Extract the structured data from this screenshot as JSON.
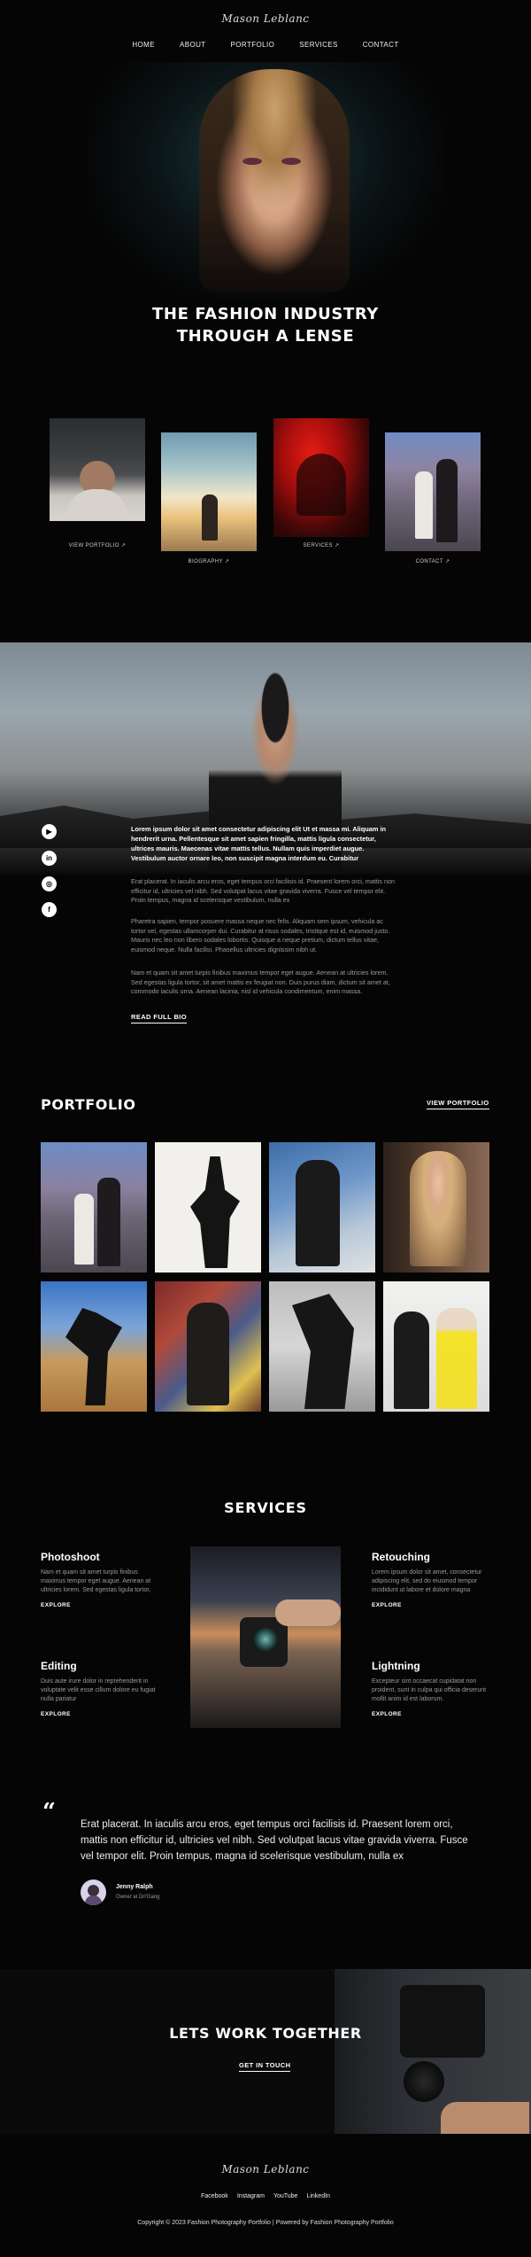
{
  "brand": {
    "logo": "Mason Leblanc"
  },
  "nav": {
    "items": [
      "HOME",
      "ABOUT",
      "PORTFOLIO",
      "SERVICES",
      "CONTACT"
    ]
  },
  "hero": {
    "title_line1": "THE FASHION INDUSTRY",
    "title_line2": "THROUGH A LENSE"
  },
  "cards": [
    {
      "label": "VIEW PORTFOLIO",
      "icon": "external-link-icon"
    },
    {
      "label": "BIOGRAPHY",
      "icon": "external-link-icon"
    },
    {
      "label": "SERVICES",
      "icon": "external-link-icon"
    },
    {
      "label": "CONTACT",
      "icon": "external-link-icon"
    }
  ],
  "social": [
    "youtube-icon",
    "linkedin-icon",
    "instagram-icon",
    "facebook-icon"
  ],
  "bio": {
    "lead": "Lorem ipsum dolor sit amet consectetur adipiscing elit Ut et massa mi. Aliquam in hendrerit urna. Pellentesque sit amet sapien fringilla, mattis ligula consectetur, ultrices mauris. Maecenas vitae mattis tellus. Nullam quis imperdiet augue. Vestibulum auctor ornare leo, non suscipit magna interdum eu. Curabitur",
    "p1": "Erat placerat. In iaculis arcu eros, eget tempus orci facilisis id. Praesent lorem orci, mattis non efficitur id, ultricies vel nibh. Sed volutpat lacus vitae gravida viverra. Fusce vel tempor elit. Proin tempus, magna id scelerisque vestibulum, nulla ex",
    "p2": "Pharetra sapien, tempor posuere massa neque nec felis. Aliquam sem ipsum, vehicula ac tortor vel, egestas ullamcorper dui. Curabitur at risus sodales, tristique est id, euismod justo. Mauris nec leo non libero sodales lobortis. Quisque a neque pretium, dictum tellus vitae, euismod neque. Nulla facilisi. Phasellus ultricies dignissim nibh ut.",
    "p3": "Nam et quam sit amet turpis finibus maximus tempor eget augue. Aenean at ultricies lorem. Sed egestas ligula tortor, sit amet mattis ex feugiat non. Duis purus diam, dictum sit amet at, commodo iaculis urna. Aenean lacinia, nisl id vehicula condimentum, enim massa.",
    "read_more": "READ FULL BIO"
  },
  "portfolio": {
    "title": "PORTFOLIO",
    "view_all": "VIEW PORTFOLIO"
  },
  "services": {
    "title": "SERVICES",
    "items": [
      {
        "name": "Photoshoot",
        "desc": "Nam et quam sit amet turpis finibus maximus tempor eget augue. Aenean at ultricies lorem. Sed egestas ligula tortor,",
        "link": "EXPLORE"
      },
      {
        "name": "Retouching",
        "desc": "Lorem ipsum dolor sit amet, consectetur adipiscing elit, sed do eiusmod tempor incididunt ut labore et dolore magna",
        "link": "EXPLORE"
      },
      {
        "name": "Editing",
        "desc": "Duis aute irure dolor in reprehenderit in voluptate velit esse cillum dolore eu fugiat nulla pariatur",
        "link": "EXPLORE"
      },
      {
        "name": "Lightning",
        "desc": "Excepteur sint occaecat cupidatat non proident, sunt in culpa qui officia deserunt mollit anim id est laborum.",
        "link": "EXPLORE"
      }
    ]
  },
  "testimonial": {
    "quote_mark": "“",
    "text": "Erat placerat. In iaculis arcu eros, eget tempus orci facilisis id. Praesent lorem orci, mattis non efficitur id, ultricies vel nibh. Sed volutpat lacus vitae gravida viverra. Fusce vel tempor elit. Proin tempus, magna id scelerisque vestibulum, nulla ex",
    "name": "Jenny Ralph",
    "role": "Owner at Dri'Gang"
  },
  "cta": {
    "title": "LETS WORK TOGETHER",
    "button": "GET IN TOUCH"
  },
  "footer": {
    "logo": "Mason Leblanc",
    "links": [
      "Facebook",
      "Instagram",
      "YouTube",
      "LinkedIn"
    ],
    "copyright": "Copyright © 2023 Fashion Photography Portfolio | Powered by Fashion Photography Portfolio"
  }
}
